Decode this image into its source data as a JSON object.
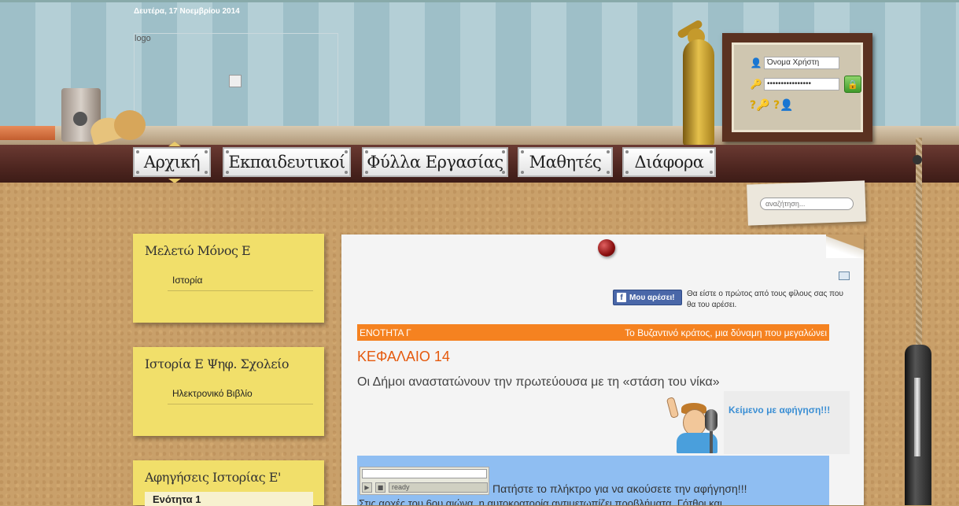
{
  "header": {
    "date": "Δευτέρα, 17 Νοεμβρίου 2014",
    "logo_alt": "logo"
  },
  "nav": {
    "items": [
      {
        "label": "Αρχική"
      },
      {
        "label": "Εκπαιδευτικοί"
      },
      {
        "label": "Φύλλα Εργασίας"
      },
      {
        "label": "Μαθητές"
      },
      {
        "label": "Διάφορα"
      }
    ]
  },
  "login": {
    "username_value": "Όνομα Χρήστη",
    "password_value": "••••••••••••••••",
    "go_icon": "lock-icon"
  },
  "search": {
    "placeholder": "αναζήτηση..."
  },
  "sidebar": {
    "notes": [
      {
        "title": "Μελετώ Μόνος Ε",
        "items": [
          "Ιστορία"
        ]
      },
      {
        "title": "Ιστορία Ε Ψηφ. Σχολείο",
        "items": [
          "Ηλεκτρονικό Βιβλίο"
        ]
      },
      {
        "title": "Αφηγήσεις Ιστορίας Ε'",
        "sub": "Ενότητα 1"
      }
    ]
  },
  "content": {
    "fb_button": "Μου αρέσει!",
    "fb_text": "Θα είστε ο πρώτος από τους φίλους σας που θα του αρέσει.",
    "unit_label": "ΕΝΟΤΗΤΑ Γ",
    "unit_title": "Το Βυζαντινό κράτος, μια δύναμη που μεγαλώνει",
    "chapter": "ΚΕΦΑΛΑΙΟ 14",
    "subtitle": "Οι Δήμοι αναστατώνουν την πρωτεύουσα με τη «στάση του νίκα»",
    "narration_label": "Κείμενο με αφήγηση!!!",
    "player_status": "ready",
    "press_text": "Πατήστε το πλήκτρο για να ακούσετε την αφήγηση!!!",
    "body_text": "Στις αρχές του 6ου αιώνα, η αυτοκρατορία αντιμετωπίζει προβλήματα. Γότθοι και"
  },
  "colors": {
    "accent_orange": "#f58220",
    "chapter_orange": "#e55a0e",
    "note_yellow": "#f1df6a",
    "nav_brown": "#4e2620",
    "fb_blue": "#4a67a8",
    "narration_blue": "#3b8fd4"
  }
}
